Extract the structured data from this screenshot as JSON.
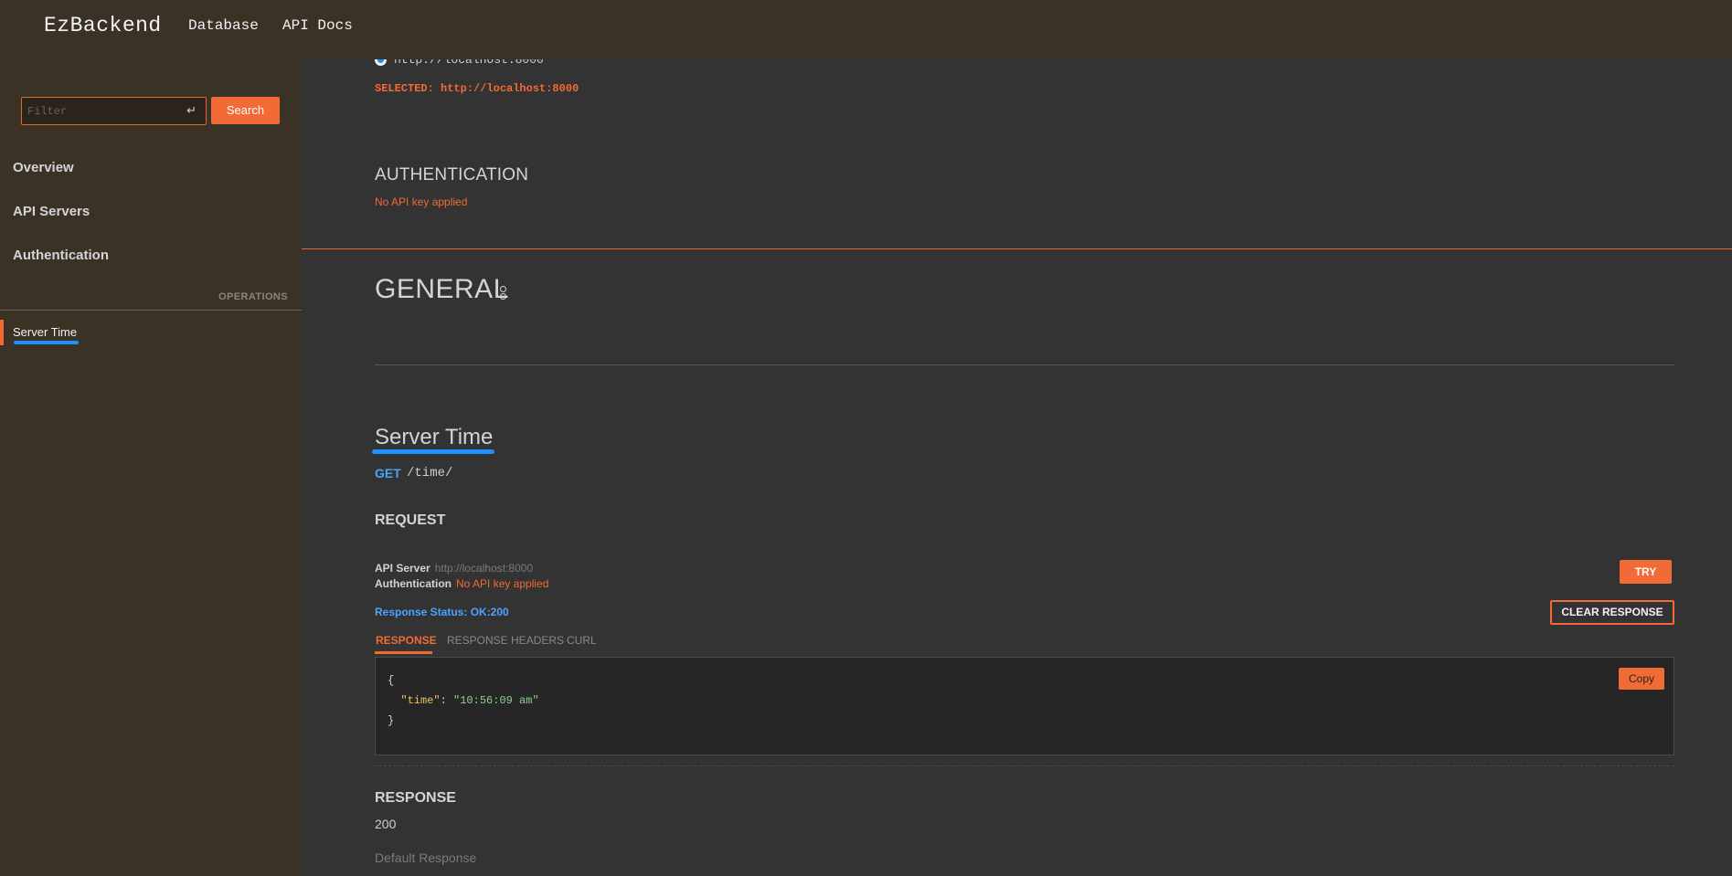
{
  "topbar": {
    "brand": "EzBackend",
    "nav": [
      "Database",
      "API Docs"
    ]
  },
  "sidebar": {
    "filter_placeholder": "Filter",
    "enter_glyph": "↵",
    "search_label": "Search",
    "items": [
      "Overview",
      "API Servers",
      "Authentication"
    ],
    "operations_label": "OPERATIONS",
    "operations": [
      "Server Time"
    ]
  },
  "main": {
    "server_url": "http://localhost:8000",
    "selected_text": "SELECTED: http://localhost:8000",
    "auth_title": "AUTHENTICATION",
    "auth_status": "No API key applied",
    "general_title": "GENERAL",
    "operation": {
      "title": "Server Time",
      "method": "GET",
      "path": "/time/",
      "request_title": "REQUEST",
      "api_server_label": "API Server",
      "api_server_value": "http://localhost:8000",
      "auth_label": "Authentication",
      "auth_value": "No API key applied",
      "try_label": "TRY",
      "clear_label": "CLEAR RESPONSE",
      "response_status": "Response Status: OK:200",
      "tabs": [
        "RESPONSE",
        "RESPONSE HEADERS",
        "CURL"
      ],
      "code": {
        "open": "{",
        "key": "\"time\"",
        "colon": ": ",
        "value": "\"10:56:09 am\"",
        "close": "}"
      },
      "copy_label": "Copy",
      "response_title": "RESPONSE",
      "response_code": "200",
      "response_desc": "Default Response"
    }
  },
  "colors": {
    "accent": "#f26a35",
    "link_blue": "#4aa3ff",
    "sidebar_bg": "#3b3226",
    "main_bg": "#333333"
  }
}
